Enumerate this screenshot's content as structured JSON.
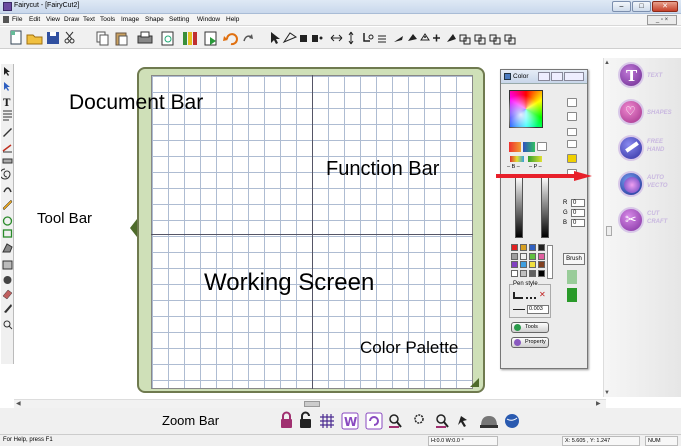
{
  "window": {
    "title": "Fairycut - [FairyCut2]",
    "controls": {
      "minimize": "–",
      "maximize": "□",
      "close": "✕"
    },
    "mdi_controls": "_ ▫ ×"
  },
  "menu": [
    "File",
    "Edit",
    "View",
    "Draw",
    "Text",
    "Tools",
    "Image",
    "Shape",
    "Setting",
    "Window",
    "Help"
  ],
  "toolbar_icons": [
    "new-file-icon",
    "open-folder-icon",
    "save-icon",
    "cut-icon",
    "copy-icon",
    "paste-icon",
    "print-icon",
    "print-preview-icon",
    "library-icon",
    "export-icon",
    "undo-icon",
    "redo-icon",
    "select-arrow-icon",
    "node-edit-icon",
    "fill-icon",
    "node-icon",
    "flip-horizontal-icon",
    "flip-vertical-icon",
    "distort-icon",
    "line-style-icon",
    "pen-icon",
    "color-fill-icon",
    "add-node-icon",
    "magic-wand-icon",
    "group-icon",
    "ungroup-icon",
    "combine-icon",
    "break-apart-icon"
  ],
  "left_tools": [
    "select-icon",
    "node-select-icon",
    "text-tool-icon",
    "vertical-text-icon",
    "pen-tool-icon",
    "line-tool-icon",
    "measure-icon",
    "spiral-icon",
    "hook-icon",
    "pencil-icon",
    "ellipse-icon",
    "rectangle-icon",
    "polygon-icon",
    "image-icon",
    "weld-icon",
    "eraser-icon",
    "knife-icon",
    "zoom-tool-icon"
  ],
  "labels": {
    "document_bar": "Document Bar",
    "function_bar": "Function Bar",
    "tool_bar": "Tool Bar",
    "working_screen": "Working Screen",
    "color_palette": "Color Palette",
    "zoom_bar": "Zoom Bar"
  },
  "palette": {
    "title": "Color",
    "minus_label": "– B –",
    "plus_label": "– P –",
    "r_label": "R",
    "r_value": "0",
    "g_label": "G",
    "g_value": "0",
    "b_label": "B",
    "b_value": "0",
    "brush_label": "Brush",
    "pen_style_label": "Pen style",
    "pen_width_value": "0.003",
    "tools_button": "Tools",
    "property_button": "Property",
    "swatch_colors": [
      "#e02020",
      "#d8a020",
      "#3060c0",
      "#202020",
      "#a0a0a0",
      "#f0f0f0",
      "#60c040",
      "#e060a0",
      "#8040c0",
      "#40a0e0",
      "#f0e040",
      "#804020",
      "#ffffff",
      "#c0c0c0",
      "#606060",
      "#000000"
    ]
  },
  "function_bar": {
    "items": [
      {
        "name": "text",
        "label": "TEXT",
        "color": "#8a3fb0"
      },
      {
        "name": "shapes",
        "label": "SHAPES",
        "color": "#c94aa8"
      },
      {
        "name": "freehand",
        "label": "FREE HAND",
        "color": "#4a4ab8"
      },
      {
        "name": "autovector",
        "label": "AUTO VECTO",
        "color": "#2a3aa8"
      },
      {
        "name": "cutcraft",
        "label": "CUT CRAFT",
        "color": "#a848b8"
      }
    ]
  },
  "zoom_bar_icons": [
    "lock-icon",
    "unlock-icon",
    "grid-icon",
    "weld-w-icon",
    "refresh-icon",
    "zoom-in-icon",
    "zoom-fit-icon",
    "zoom-out-icon",
    "pan-icon",
    "cut-machine-icon",
    "globe-icon"
  ],
  "status": {
    "help": "For Help, press F1",
    "dims": "H:0.0  W:0.0 °",
    "coords": "X: 5.605 , Y: 1.247",
    "num": "NUM"
  },
  "colors": {
    "accent_red": "#e8202a",
    "canvas_border": "#cfe0b8"
  }
}
